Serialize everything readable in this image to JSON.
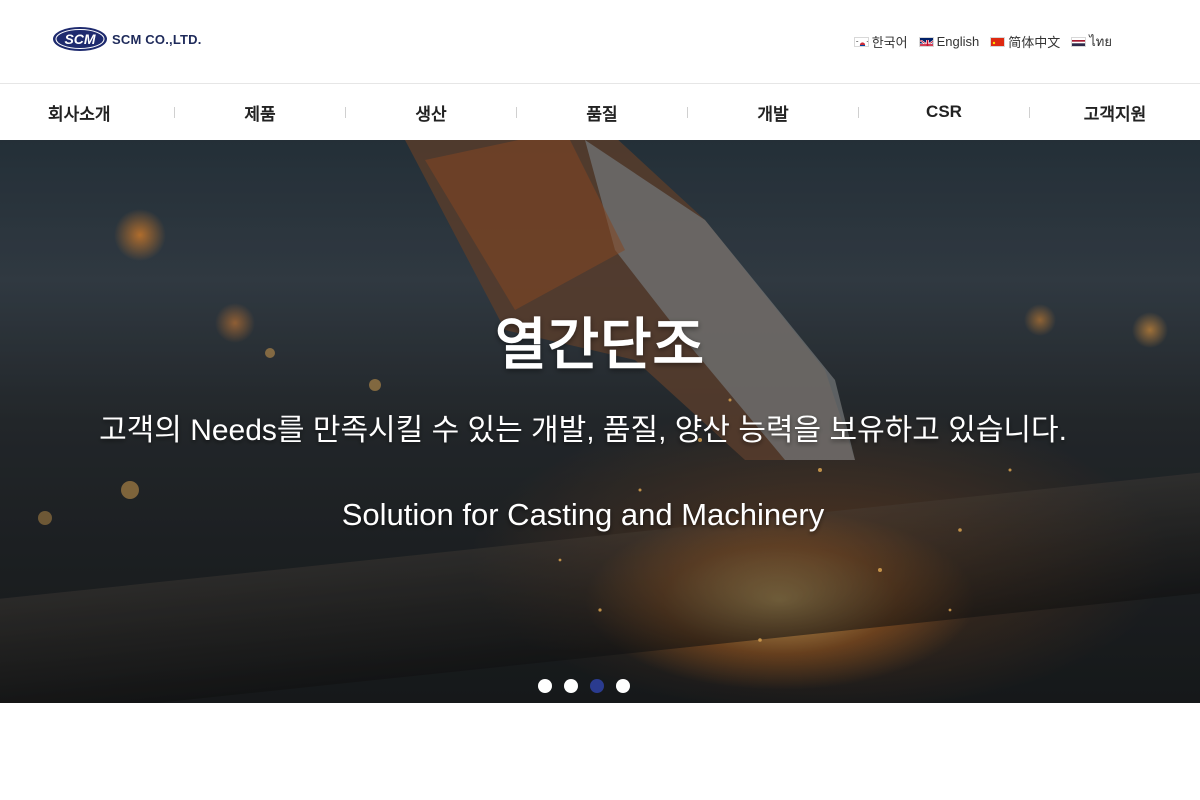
{
  "brand": {
    "logo_mark_text": "SCM",
    "company_name": "SCM CO.,LTD.",
    "color": "#1e2a5a"
  },
  "languages": [
    {
      "label": "한국어",
      "flag": "kr-flag-icon"
    },
    {
      "label": "English",
      "flag": "uk-flag-icon"
    },
    {
      "label": "简体中文",
      "flag": "cn-flag-icon"
    },
    {
      "label": "ไทย",
      "flag": "th-flag-icon"
    }
  ],
  "nav": {
    "items": [
      {
        "label": "회사소개"
      },
      {
        "label": "제품"
      },
      {
        "label": "생산"
      },
      {
        "label": "품질"
      },
      {
        "label": "개발"
      },
      {
        "label": "CSR"
      },
      {
        "label": "고객지원"
      }
    ]
  },
  "hero": {
    "title": "열간단조",
    "subtitle": "고객의 Needs를 만족시킬 수 있는 개발, 품질, 양산 능력을 보유하고 있습니다.",
    "tagline": "Solution for Casting and Machinery",
    "slides_total": 4,
    "active_slide": 3,
    "active_dot_color": "#2a3b8f"
  }
}
